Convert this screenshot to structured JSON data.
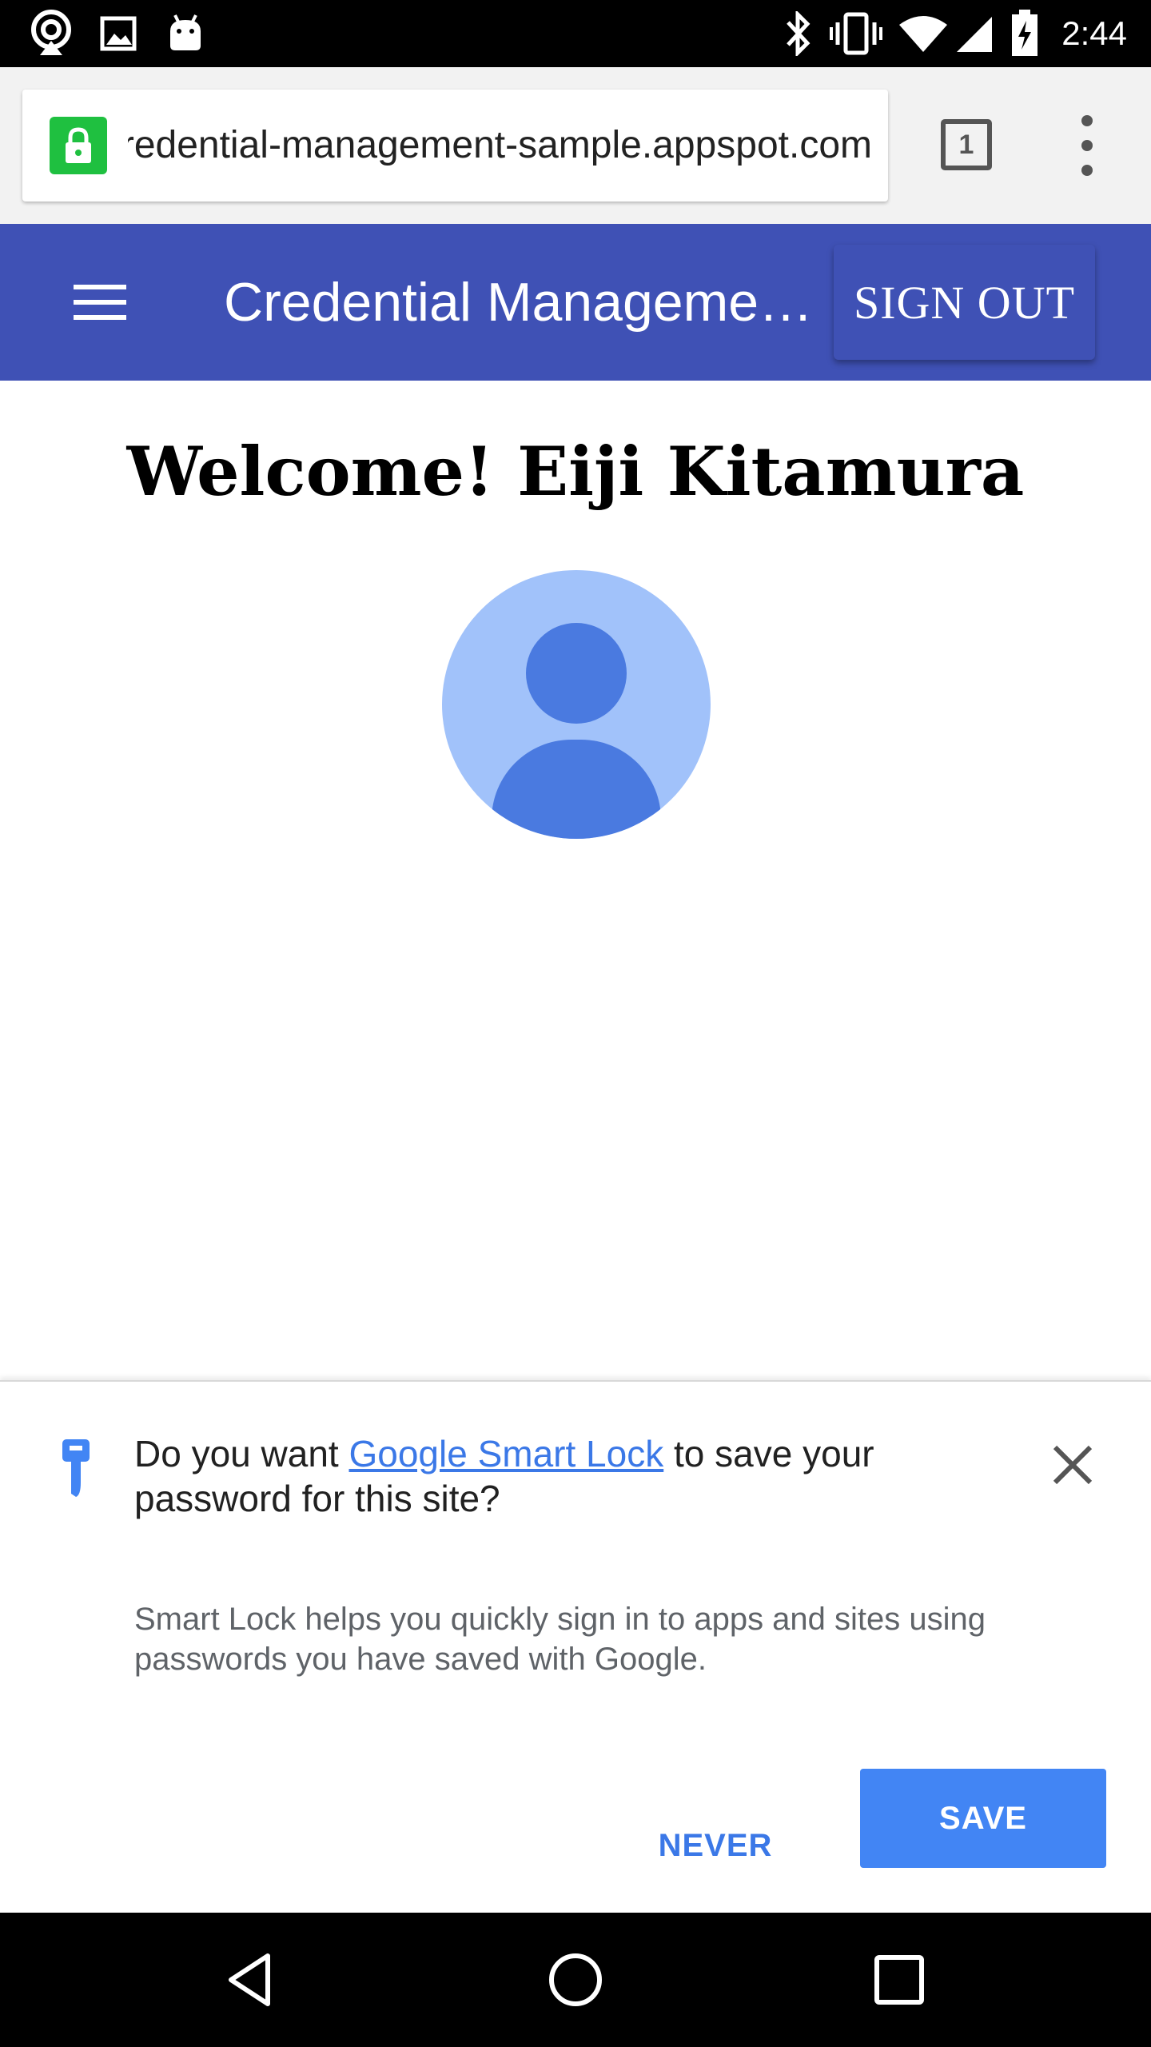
{
  "status_bar": {
    "time": "2:44",
    "icons": [
      "hotspot-icon",
      "image-icon",
      "android-icon",
      "bluetooth-icon",
      "vibrate-icon",
      "wifi-icon",
      "signal-icon",
      "battery-charging-icon"
    ]
  },
  "browser": {
    "url": "credential-management-sample.appspot.com",
    "tab_count": "1"
  },
  "app_bar": {
    "title": "Credential Manageme…",
    "sign_out_label": "SIGN OUT",
    "color": "#3f51b5"
  },
  "main": {
    "welcome": "Welcome! Eiji Kitamura"
  },
  "smart_lock": {
    "prompt_before": "Do you want ",
    "prompt_link": "Google Smart Lock",
    "prompt_after": " to save your password for this site?",
    "help_text": "Smart Lock helps you quickly sign in to apps and sites using passwords you have saved with Google.",
    "never_label": "NEVER",
    "save_label": "SAVE",
    "accent": "#4285f4"
  },
  "nav_bar": {
    "icons": [
      "back-icon",
      "home-icon",
      "recents-icon"
    ]
  }
}
